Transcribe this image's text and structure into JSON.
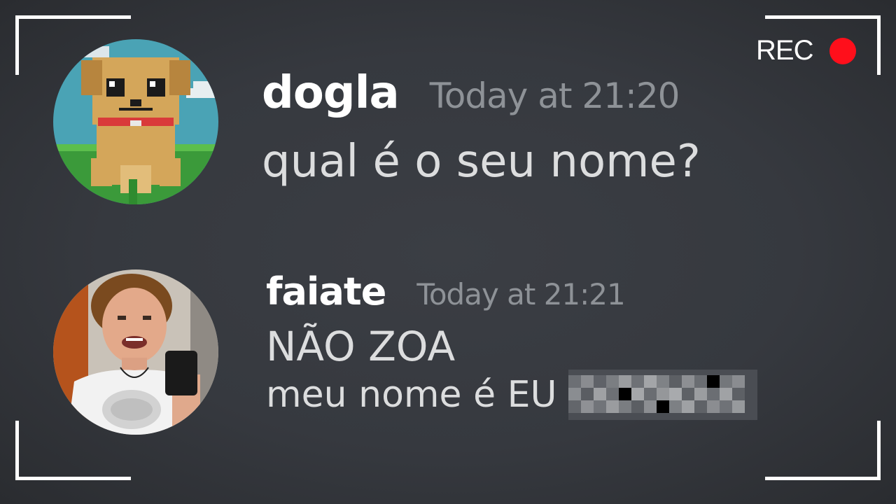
{
  "recording": {
    "label": "REC",
    "dot_color": "#ff0f1b"
  },
  "messages": [
    {
      "username": "dogla",
      "timestamp": "Today at 21:20",
      "text": "qual é o seu nome?",
      "avatar_icon": "pixel-dog-avatar"
    },
    {
      "username": "faiate",
      "timestamp": "Today at 21:21",
      "line1": "NÃO ZOA",
      "line2": "meu nome é EU",
      "avatar_icon": "user-photo-avatar",
      "censored": true
    }
  ],
  "colors": {
    "background": "#36393f",
    "username": "#ffffff",
    "timestamp": "#8e9297",
    "message_text": "#dcddde"
  }
}
